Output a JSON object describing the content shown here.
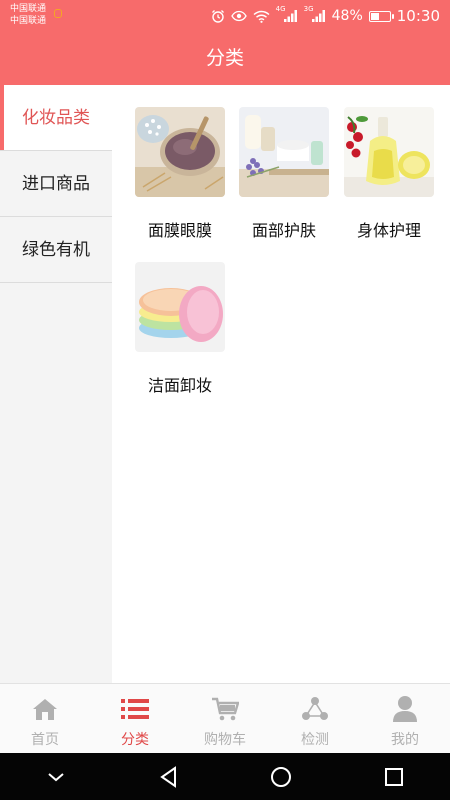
{
  "status_bar": {
    "carrier_1": "中国联通",
    "carrier_2": "中国联通",
    "net_1": "4G",
    "net_2": "3G",
    "battery": "48%",
    "battery_level": 0.48,
    "time": "10:30"
  },
  "header": {
    "title": "分类"
  },
  "sidebar": {
    "items": [
      {
        "label": "化妆品类",
        "active": true
      },
      {
        "label": "进口商品",
        "active": false
      },
      {
        "label": "绿色有机",
        "active": false
      }
    ]
  },
  "categories": [
    {
      "label": "面膜眼膜",
      "image": "mask-bowl-photo"
    },
    {
      "label": "面部护肤",
      "image": "skincare-jars-photo"
    },
    {
      "label": "身体护理",
      "image": "body-oil-photo"
    },
    {
      "label": "洁面卸妆",
      "image": "cleansing-sponges-photo"
    }
  ],
  "tabbar": {
    "items": [
      {
        "label": "首页",
        "icon": "home-icon",
        "active": false
      },
      {
        "label": "分类",
        "icon": "list-icon",
        "active": true
      },
      {
        "label": "购物车",
        "icon": "cart-icon",
        "active": false
      },
      {
        "label": "检测",
        "icon": "network-icon",
        "active": false
      },
      {
        "label": "我的",
        "icon": "person-icon",
        "active": false
      }
    ]
  },
  "colors": {
    "accent": "#f76b6b",
    "active_text": "#e05555",
    "inactive_tab": "#b0b0b0"
  }
}
